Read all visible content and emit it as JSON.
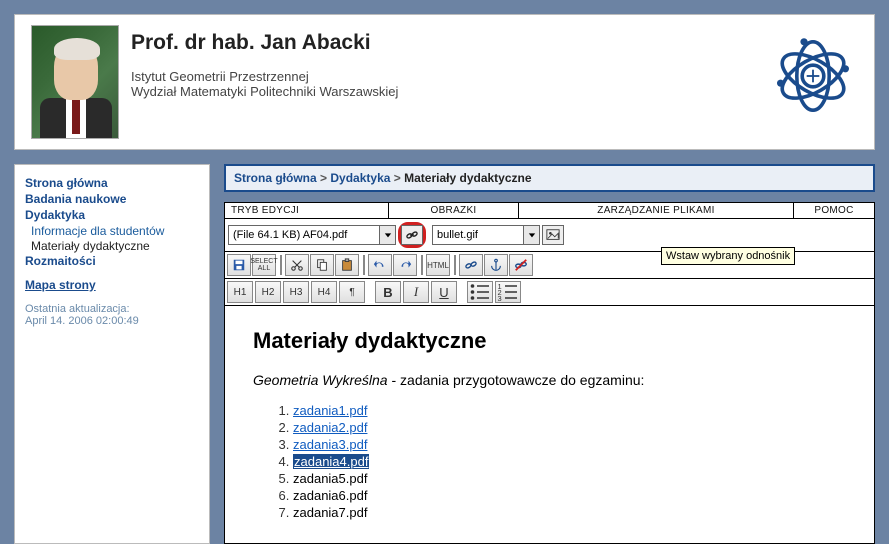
{
  "header": {
    "title": "Prof. dr hab. Jan Abacki",
    "line1": "Istytut Geometrii Przestrzennej",
    "line2": "Wydział Matematyki Politechniki Warszawskiej"
  },
  "sidebar": {
    "items": [
      {
        "label": "Strona główna",
        "type": "link"
      },
      {
        "label": "Badania naukowe",
        "type": "link"
      },
      {
        "label": "Dydaktyka",
        "type": "link"
      },
      {
        "label": "Informacje dla studentów",
        "type": "sub"
      },
      {
        "label": "Materiały dydaktyczne",
        "type": "current"
      },
      {
        "label": "Rozmaitości",
        "type": "link"
      }
    ],
    "sitemap": "Mapa strony",
    "meta1": "Ostatnia aktualizacja:",
    "meta2": "April 14. 2006 02:00:49"
  },
  "breadcrumb": {
    "p1": "Strona główna",
    "p2": "Dydaktyka",
    "p3": "Materiały dydaktyczne",
    "sep": ">"
  },
  "menus": {
    "m1": "TRYB EDYCJI",
    "m2": "OBRAZKI",
    "m3": "ZARZĄDZANIE PLIKAMI",
    "m4": "POMOC"
  },
  "file_picker": {
    "file_value": "(File 64.1 KB) AF04.pdf",
    "image_value": "bullet.gif"
  },
  "tooltip": "Wstaw wybrany odnośnik",
  "fmt_buttons": {
    "h1": "H1",
    "h2": "H2",
    "h3": "H3",
    "h4": "H4",
    "para": "¶",
    "b": "B",
    "i": "I",
    "u": "U"
  },
  "content": {
    "heading": "Materiały dydaktyczne",
    "subtitle_em": "Geometria Wykreślna",
    "subtitle_rest": " - zadania przygotowawcze do egzaminu:",
    "items": [
      {
        "label": "zadania1.pdf",
        "state": "link"
      },
      {
        "label": "zadania2.pdf",
        "state": "link"
      },
      {
        "label": "zadania3.pdf",
        "state": "link"
      },
      {
        "label": "zadania4.pdf",
        "state": "selected"
      },
      {
        "label": "zadania5.pdf",
        "state": "plain"
      },
      {
        "label": "zadania6.pdf",
        "state": "plain"
      },
      {
        "label": "zadania7.pdf",
        "state": "plain"
      }
    ]
  }
}
